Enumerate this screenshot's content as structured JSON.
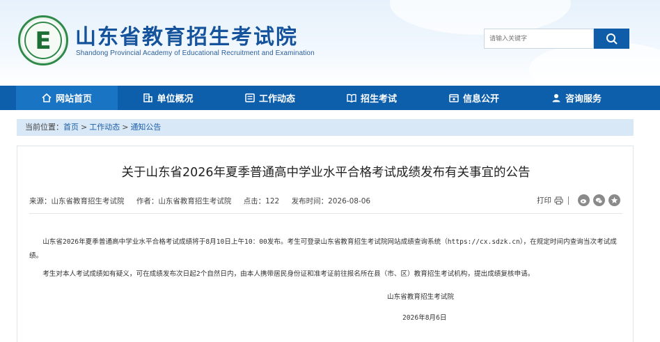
{
  "header": {
    "logo_letter": "E",
    "title": "山东省教育招生考试院",
    "subtitle": "Shandong Provincial Academy of Educational Recruitment and Examination",
    "search_placeholder": "请输入关键字"
  },
  "nav": {
    "items": [
      {
        "label": "网站首页",
        "icon": "home-icon",
        "active": true
      },
      {
        "label": "单位概况",
        "icon": "building-icon",
        "active": false
      },
      {
        "label": "工作动态",
        "icon": "news-icon",
        "active": false
      },
      {
        "label": "招生考试",
        "icon": "exam-book-icon",
        "active": false
      },
      {
        "label": "信息公开",
        "icon": "info-card-icon",
        "active": false
      },
      {
        "label": "咨询服务",
        "icon": "service-user-icon",
        "active": false
      }
    ]
  },
  "breadcrumb": {
    "prefix": "当前位置：",
    "items": [
      "首页",
      "工作动态",
      "通知公告"
    ],
    "separator": ">"
  },
  "article": {
    "title": "关于山东省2026年夏季普通高中学业水平合格考试成绩发布有关事宜的公告",
    "meta": {
      "source": "来源：山东省教育招生考试院",
      "author": "作者：山东省教育招生考试院",
      "clicks": "点击：122",
      "published": "发布时间：2026-08-06"
    },
    "tools": {
      "print": "打印",
      "share_icons": [
        "weibo-icon",
        "wechat-icon",
        "qzone-icon"
      ]
    },
    "paragraphs": [
      "山东省2026年夏季普通高中学业水平合格考试成绩将于8月10日上午10：00发布。考生可登录山东省教育招生考试院网站成绩查询系统（https://cx.sdzk.cn），在规定时间内查询当次考试成绩。",
      "考生对本人考试成绩如有疑义，可在成绩发布次日起2个自然日内，由本人携带居民身份证和准考证前往报名所在县（市、区）教育招生考试机构，提出成绩复核申请。"
    ],
    "signature": "山东省教育招生考试院",
    "date": "2026年8月6日"
  },
  "colors": {
    "nav_bg": "#0d5fac",
    "nav_active": "#1a74c4",
    "title_blue": "#15539c",
    "breadcrumb_bg": "#d8e8f7",
    "logo_green": "#2f8a4a"
  }
}
